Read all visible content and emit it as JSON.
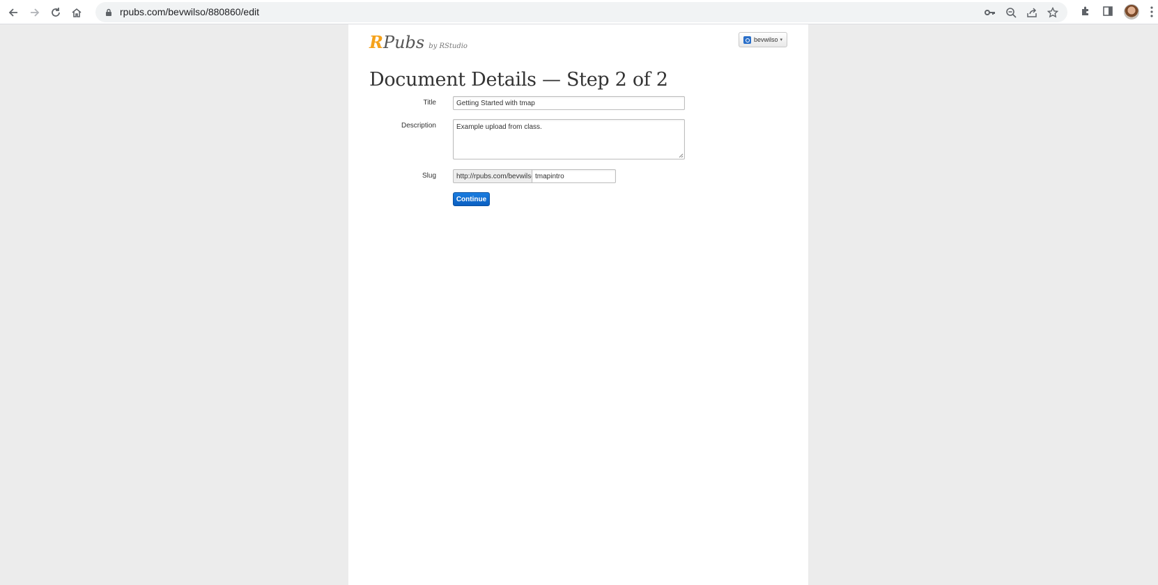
{
  "browser": {
    "url": "rpubs.com/bevwilso/880860/edit"
  },
  "header": {
    "logo_r": "R",
    "logo_pubs": "Pubs",
    "logo_by": "by RStudio",
    "user_label": "bevwilso",
    "caret": "▾"
  },
  "page_title": "Document Details — Step 2 of 2",
  "form": {
    "title_label": "Title",
    "title_value": "Getting Started with tmap",
    "description_label": "Description",
    "description_value": "Example upload from class.",
    "slug_label": "Slug",
    "slug_prefix": "http://rpubs.com/bevwilso/",
    "slug_value": "tmapintro",
    "continue_label": "Continue"
  },
  "colors": {
    "logo_accent": "#f5a21b",
    "button_blue": "#0b5fc1"
  }
}
